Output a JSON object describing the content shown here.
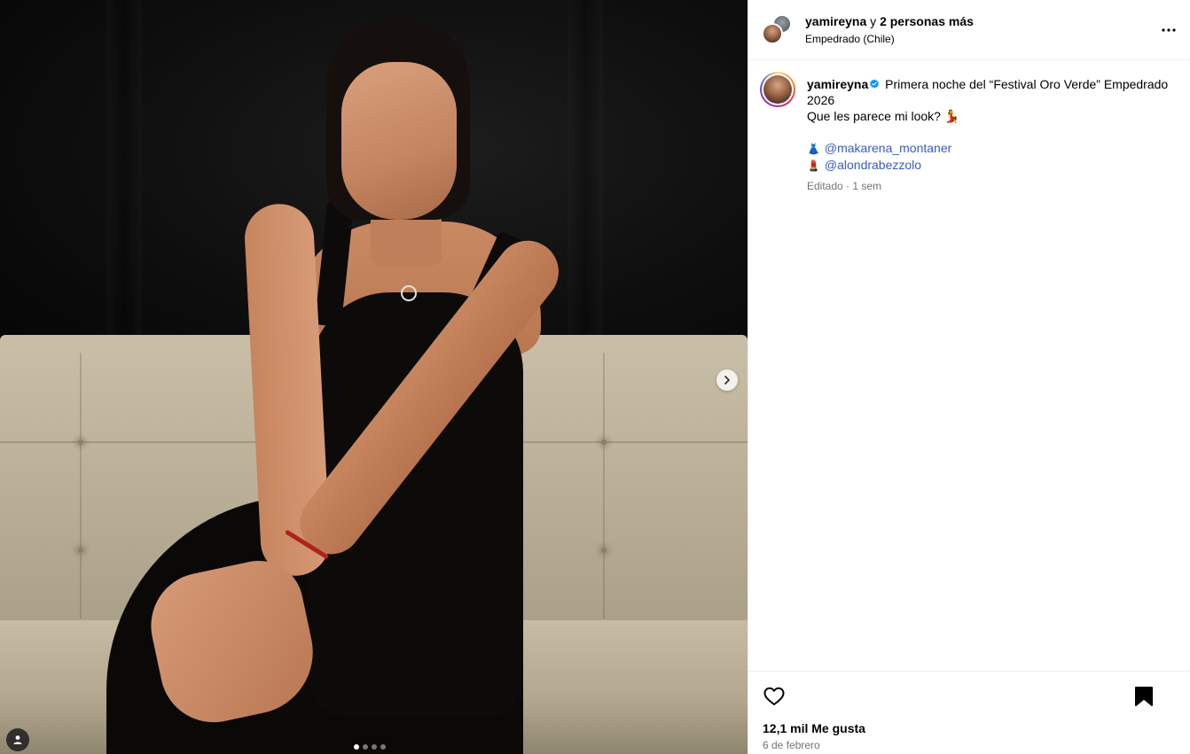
{
  "header": {
    "username": "yamireyna",
    "conjunction": "y",
    "others": "2 personas más",
    "location": "Empedrado (Chile)",
    "more_icon": "more-horizontal-icon"
  },
  "caption": {
    "username": "yamireyna",
    "verified": true,
    "text_line1": "Primera noche del “Festival Oro Verde” Empedrado 2026",
    "text_line2": "Que les parece mi look? 💃",
    "credits": [
      {
        "emoji": "👗",
        "mention": "@makarena_montaner"
      },
      {
        "emoji": "💄",
        "mention": "@alondrabezzolo"
      }
    ],
    "meta": "Editado · 1 sem"
  },
  "actions": {
    "likes": "12,1 mil Me gusta",
    "date": "6 de febrero"
  },
  "media": {
    "carousel_count": 4,
    "carousel_active_index": 0
  },
  "colors": {
    "mention": "#385bc9",
    "verified": "#0095f6",
    "muted": "#737373",
    "divider": "#efefef"
  }
}
